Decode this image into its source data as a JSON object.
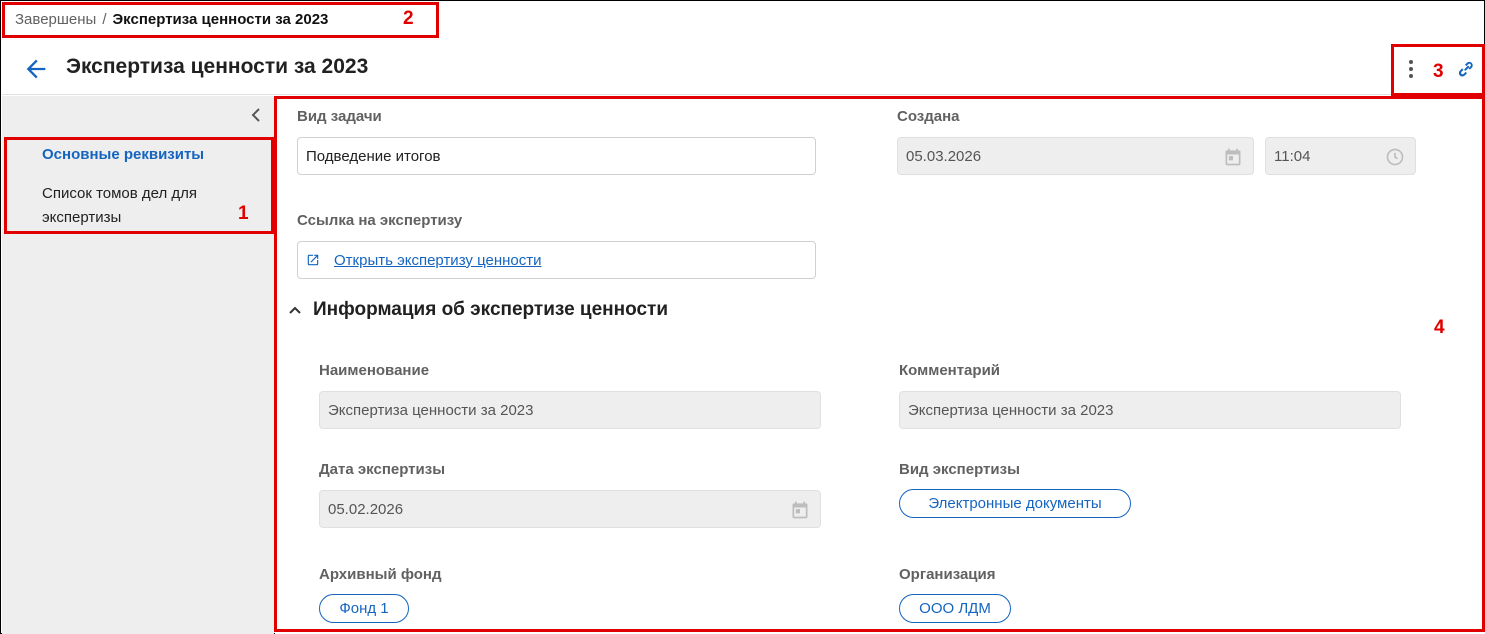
{
  "breadcrumb": {
    "parent": "Завершены",
    "separator": "/",
    "current": "Экспертиза ценности за 2023"
  },
  "header": {
    "title": "Экспертиза ценности за 2023"
  },
  "sidebar": {
    "items": [
      {
        "label": "Основные реквизиты",
        "active": true
      },
      {
        "label": "Список томов дел для экспертизы",
        "active": false
      }
    ]
  },
  "main": {
    "task_type": {
      "label": "Вид задачи",
      "value": "Подведение итогов"
    },
    "created": {
      "label": "Создана",
      "date": "05.03.2026",
      "time": "11:04"
    },
    "expertise_link": {
      "label": "Ссылка на экспертизу",
      "link_text": "Открыть экспертизу ценности"
    },
    "section": {
      "title": "Информация об экспертизе ценности",
      "name": {
        "label": "Наименование",
        "value": "Экспертиза ценности за 2023"
      },
      "comment": {
        "label": "Комментарий",
        "value": "Экспертиза ценности за 2023"
      },
      "expertise_date": {
        "label": "Дата экспертизы",
        "value": "05.02.2026"
      },
      "expertise_type": {
        "label": "Вид экспертизы",
        "value": "Электронные документы"
      },
      "archive_fund": {
        "label": "Архивный фонд",
        "value": "Фонд 1"
      },
      "organization": {
        "label": "Организация",
        "value": "ООО ЛДМ"
      }
    }
  },
  "annotations": {
    "n1": "1",
    "n2": "2",
    "n3": "3",
    "n4": "4"
  },
  "icons": {
    "back": "arrow-left-icon",
    "more": "more-vertical-icon",
    "link": "link-icon",
    "collapse": "chevron-left-icon",
    "calendar": "calendar-icon",
    "clock": "clock-icon",
    "external": "external-link-icon",
    "section_toggle": "chevron-up-icon"
  },
  "colors": {
    "accent": "#1565c0",
    "annotation": "#e00000",
    "sidebar_bg": "#eeeeee"
  }
}
